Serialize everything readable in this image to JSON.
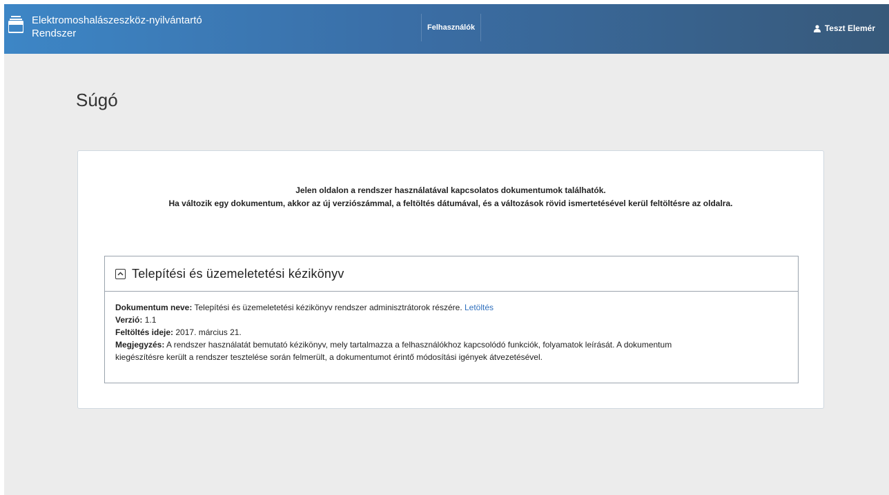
{
  "header": {
    "app_title_line1": "Elektromoshalászeszköz-nyilvántartó",
    "app_title_line2": "Rendszer",
    "nav_users": "Felhasználók",
    "user_name": "Teszt Elemér",
    "brand_icon": "archive-box-icon",
    "user_icon": "user-icon"
  },
  "page": {
    "title": "Súgó"
  },
  "intro": {
    "line1": "Jelen oldalon a rendszer használatával kapcsolatos dokumentumok találhatók.",
    "line2": "Ha változik egy dokumentum, akkor az új verziószámmal, a feltöltés dátumával, és a változások rövid ismertetésével kerül feltöltésre az oldalra."
  },
  "document": {
    "title": "Telepítési és üzemeletetési kézikönyv",
    "toggle_icon": "chevron-up-icon",
    "name_label": "Dokumentum neve:",
    "name_value": "Telepítési és üzemeletetési kézikönyv rendszer adminisztrátorok részére.",
    "download_link": "Letöltés",
    "version_label": "Verzió:",
    "version_value": "1.1",
    "upload_label": "Feltöltés ideje:",
    "upload_value": "2017. március 21.",
    "note_label": "Megjegyzés:",
    "note_value_line1": "A rendszer használatát bemutató kézikönyv, mely tartalmazza a felhasználókhoz kapcsolódó funkciók, folyamatok leírását. A dokumentum",
    "note_value_line2": "kiegészítésre került a rendszer tesztelése során felmerült, a dokumentumot érintő módosítási igények átvezetésével."
  },
  "colors": {
    "header_start": "#3d86c6",
    "header_end": "#37597a",
    "link": "#2f6fbd",
    "background": "#ececec"
  }
}
